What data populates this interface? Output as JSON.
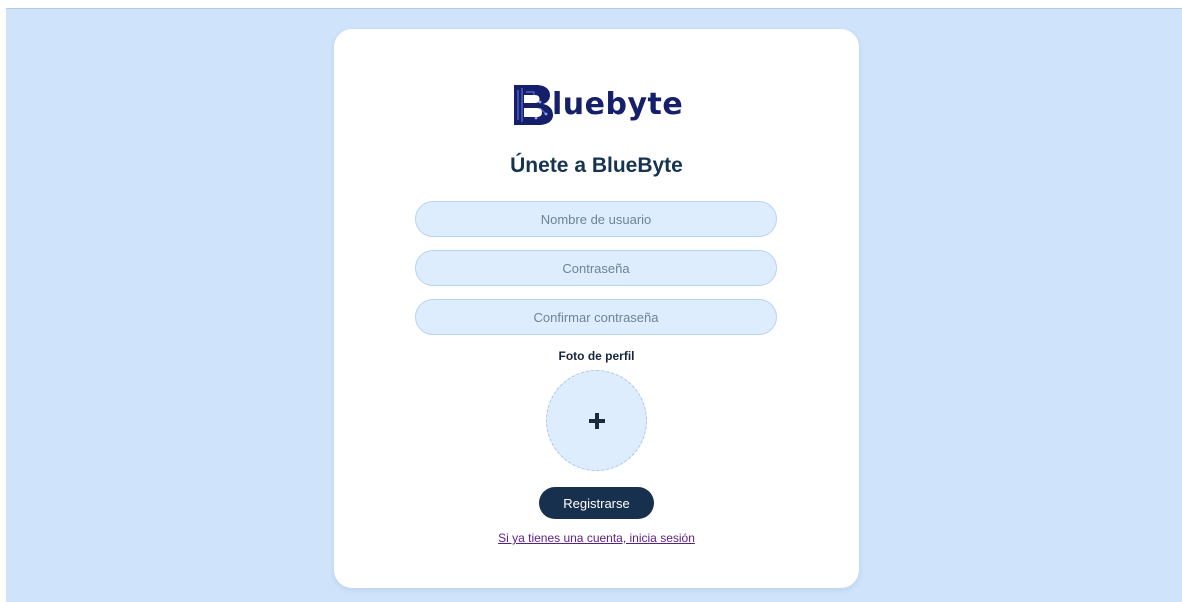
{
  "logo": {
    "icon": "bluebyte-circuit-b-logo",
    "text": "luebyte"
  },
  "form": {
    "title": "Únete a BlueByte",
    "username_placeholder": "Nombre de usuario",
    "password_placeholder": "Contraseña",
    "confirm_placeholder": "Confirmar contraseña",
    "photo_label": "Foto de perfil",
    "photo_icon": "plus-icon",
    "submit_label": "Registrarse",
    "login_link": "Si ya tienes una cuenta, inicia sesión"
  },
  "colors": {
    "page_background": "#cfe3fb",
    "card_background": "#ffffff",
    "input_background": "#deedfd",
    "primary_button": "#17304d",
    "logo": "#16206a",
    "link": "#5a1f8a"
  }
}
